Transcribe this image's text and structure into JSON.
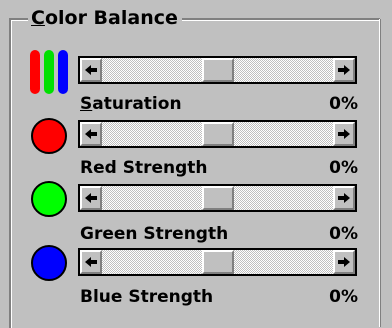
{
  "group": {
    "title": "Color Balance",
    "hotkey": "C",
    "title_rest": "olor Balance"
  },
  "rows": [
    {
      "icon": "rgb-bars-icon",
      "label": "Saturation",
      "hotkey": "S",
      "label_rest": "aturation",
      "value": "0%",
      "slider_fraction": 0.5
    },
    {
      "icon": "red-circle-icon",
      "color": "#ff0000",
      "label": "Red Strength",
      "value": "0%",
      "slider_fraction": 0.5
    },
    {
      "icon": "green-circle-icon",
      "color": "#00ff00",
      "label": "Green Strength",
      "value": "0%",
      "slider_fraction": 0.5
    },
    {
      "icon": "blue-circle-icon",
      "color": "#0000ff",
      "label": "Blue Strength",
      "value": "0%",
      "slider_fraction": 0.5
    }
  ],
  "rgb_bar_colors": [
    "#ff0000",
    "#00e000",
    "#0000ff"
  ]
}
